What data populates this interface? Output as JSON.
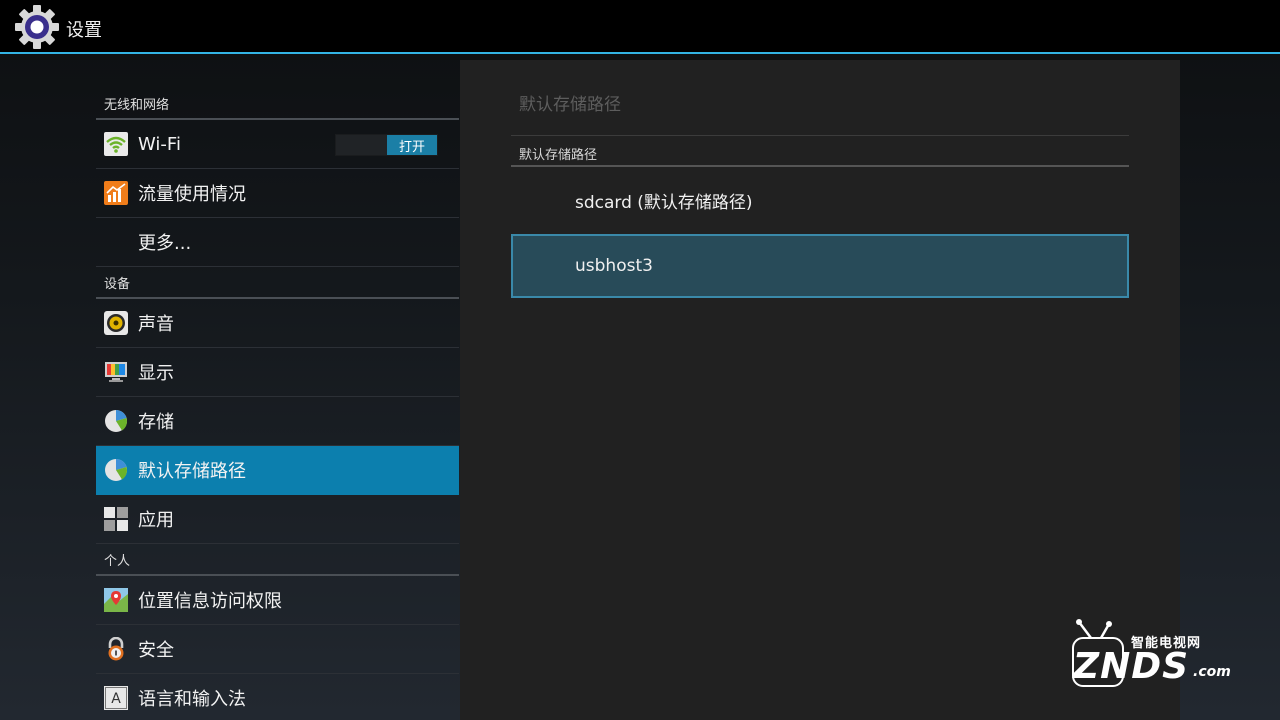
{
  "app": {
    "title": "设置",
    "icon": "settings-gear-icon"
  },
  "sidebar": {
    "sections": [
      {
        "header": "无线和网络",
        "items": [
          {
            "label": "Wi-Fi",
            "icon": "wifi-icon",
            "toggle": "打开"
          },
          {
            "label": "流量使用情况",
            "icon": "data-usage-icon"
          },
          {
            "label": "更多...",
            "icon": ""
          }
        ]
      },
      {
        "header": "设备",
        "items": [
          {
            "label": "声音",
            "icon": "speaker-icon"
          },
          {
            "label": "显示",
            "icon": "display-icon"
          },
          {
            "label": "存储",
            "icon": "storage-icon"
          },
          {
            "label": "默认存储路径",
            "icon": "storage-path-icon",
            "selected": true
          },
          {
            "label": "应用",
            "icon": "apps-icon"
          }
        ]
      },
      {
        "header": "个人",
        "items": [
          {
            "label": "位置信息访问权限",
            "icon": "location-icon"
          },
          {
            "label": "安全",
            "icon": "lock-icon"
          },
          {
            "label": "语言和输入法",
            "icon": "language-icon"
          }
        ]
      }
    ]
  },
  "detail": {
    "title": "默认存储路径",
    "category": "默认存储路径",
    "options": [
      {
        "label": "sdcard (默认存储路径)"
      },
      {
        "label": "usbhost3",
        "focused": true
      }
    ]
  },
  "watermark": {
    "small": "智能电视网",
    "big": "ZNDS",
    "suffix": ".com"
  },
  "colors": {
    "accent": "#33b5e5",
    "selected": "#0c7fae",
    "focus": "#284b59"
  }
}
